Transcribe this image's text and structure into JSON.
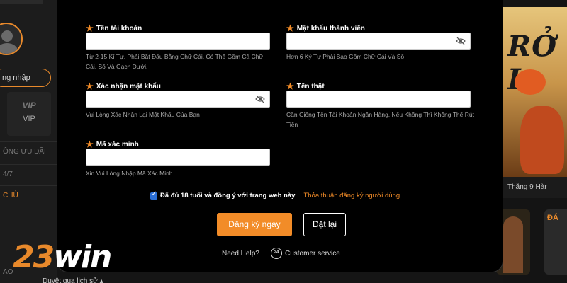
{
  "sidebar": {
    "login_label": "ng nhập",
    "vip_icon": "VIP",
    "vip_label": "VIP",
    "items": [
      {
        "label": "ÔNG ƯU ĐÃI"
      },
      {
        "label": "4/7"
      },
      {
        "label": "CHỦ"
      },
      {
        "label": ""
      },
      {
        "label": "AO"
      }
    ]
  },
  "modal": {
    "fields": {
      "username": {
        "label": "Tên tài khoản",
        "hint": "Từ 2-15 Kí Tự, Phải Bắt Đầu Bằng Chữ Cái, Có Thể Gồm Cả Chữ Cái, Số Và Gạch Dưới."
      },
      "password": {
        "label": "Mật khẩu thành viên",
        "hint": "Hơn 6 Ký Tự Phải Bao Gồm Chữ Cái Và Số"
      },
      "confirm_password": {
        "label": "Xác nhận mật khẩu",
        "hint": "Vui Lòng Xác Nhận Lại Mật Khẩu Của Bạn"
      },
      "real_name": {
        "label": "Tên thật",
        "hint": "Cần Giống Tên Tài Khoản Ngân Hàng, Nếu Không Thì Không Thể Rút Tiền"
      },
      "captcha": {
        "label": "Mã xác minh",
        "hint": "Xin Vui Lòng Nhập Mã Xác Minh"
      }
    },
    "agree_text": "Đã đủ 18 tuổi và đồng ý với trang web này",
    "terms_link": "Thỏa thuận đăng ký người dùng",
    "register_button": "Đăng ký ngay",
    "reset_button": "Đặt lại",
    "help_text": "Need Help?",
    "customer_service": "Customer service",
    "cs_icon_text": "24"
  },
  "promo": {
    "banner_title": "RỞ L",
    "strip_text": "Thắng 9 Hàr",
    "card2_label": "ĐÁ"
  },
  "brand": {
    "num": "23",
    "name": "win"
  },
  "history_text": "Duyệt qua lịch sử ▴",
  "colors": {
    "accent": "#f28c28",
    "background": "#000000"
  }
}
